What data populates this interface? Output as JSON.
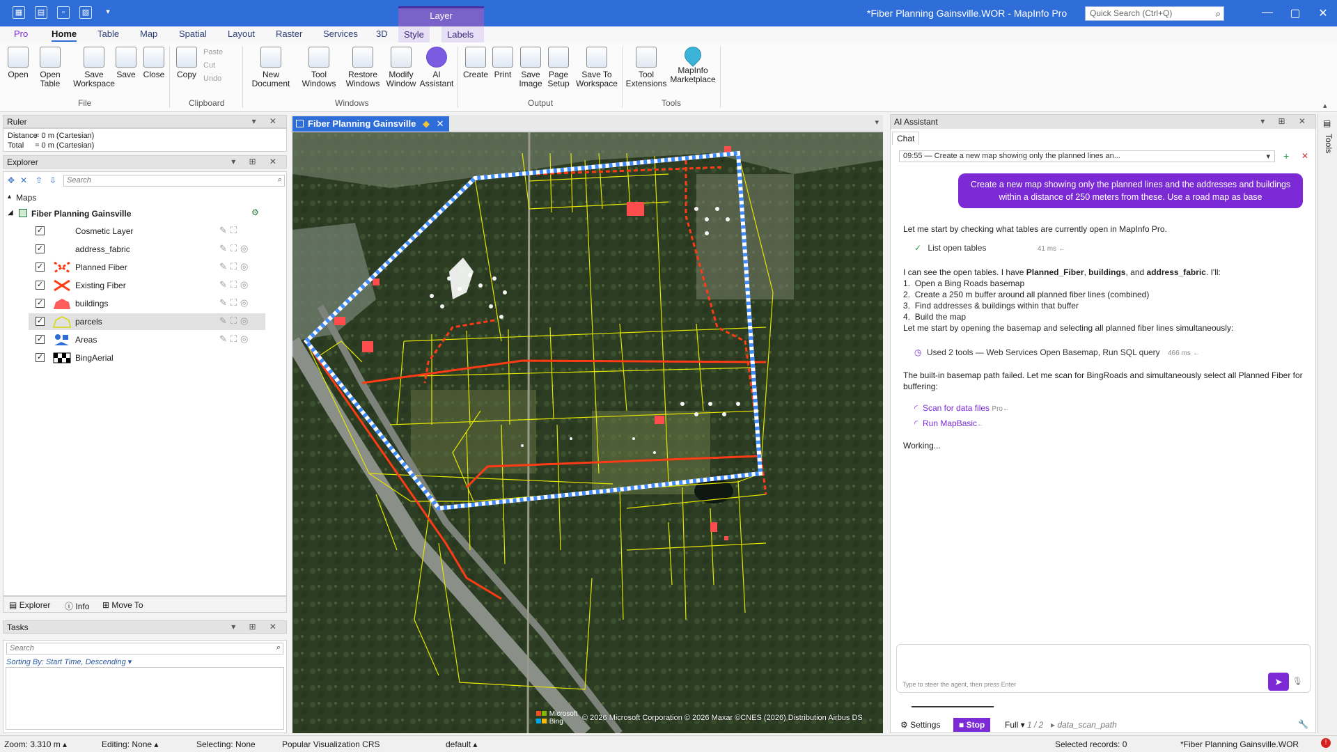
{
  "app": {
    "window_title": "*Fiber Planning Gainsville.WOR - MapInfo Pro",
    "quick_search_placeholder": "Quick Search (Ctrl+Q)",
    "context_group": "Layer",
    "accent": "#2f6ed8",
    "ai_accent": "#7b2ad6"
  },
  "ribbon": {
    "tabs": [
      "Pro",
      "Home",
      "Table",
      "Map",
      "Spatial",
      "Layout",
      "Raster",
      "Services",
      "3D",
      "Style",
      "Labels"
    ],
    "active_tab": "Home",
    "groups": [
      {
        "label": "File",
        "buttons": [
          "Open",
          "Open Table",
          "Save Workspace",
          "Save",
          "Close"
        ]
      },
      {
        "label": "Clipboard",
        "buttons": [
          "Copy"
        ],
        "small": [
          "Paste",
          "Cut",
          "Undo"
        ]
      },
      {
        "label": "Windows",
        "buttons": [
          "New Document",
          "Tool Windows",
          "Restore Windows",
          "Modify Window",
          "AI Assistant"
        ]
      },
      {
        "label": "Output",
        "buttons": [
          "Create",
          "Print",
          "Save Image",
          "Page Setup",
          "Save To Workspace"
        ]
      },
      {
        "label": "Tools",
        "buttons": [
          "Tool Extensions",
          "MapInfo Marketplace"
        ]
      }
    ]
  },
  "ruler": {
    "title": "Ruler",
    "distance_label": "Distance",
    "distance_value": "= 0 m (Cartesian)",
    "total_label": "Total",
    "total_value": "= 0 m (Cartesian)"
  },
  "explorer": {
    "title": "Explorer",
    "search_placeholder": "Search",
    "maps_label": "Maps",
    "map_name": "Fiber Planning Gainsville",
    "layers": [
      {
        "name": "Cosmetic Layer",
        "checked": true
      },
      {
        "name": "address_fabric",
        "checked": true
      },
      {
        "name": "Planned Fiber",
        "checked": true
      },
      {
        "name": "Existing Fiber",
        "checked": true
      },
      {
        "name": "buildings",
        "checked": true
      },
      {
        "name": "parcels",
        "checked": true,
        "selected": true
      },
      {
        "name": "Areas",
        "checked": true
      },
      {
        "name": "BingAerial",
        "checked": true
      }
    ],
    "bottom_tabs": [
      "Explorer",
      "Info",
      "Move To"
    ]
  },
  "tasks": {
    "title": "Tasks",
    "search_placeholder": "Search",
    "sort_label": "Sorting By: Start Time, Descending"
  },
  "map_window": {
    "tab_title": "Fiber Planning Gainsville",
    "attribution": "© 2026 Microsoft Corporation © 2026 Maxar ©CNES (2026) Distribution Airbus DS",
    "logo_text_1": "Microsoft",
    "logo_text_2": "Bing"
  },
  "ai_assistant": {
    "title": "AI Assistant",
    "chat_tab": "Chat",
    "session_label": "09:55  —  Create a new map showing only the planned lines an...",
    "user_message": "Create a new map showing only the planned lines and the addresses and buildings within a distance of 250 meters from these. Use a road map as base",
    "msg1": "Let me start by checking what tables are currently open in MapInfo Pro.",
    "tool1": "List open tables",
    "tool1_ms": "41 ms",
    "msg2_prefix": "I can see the open tables. I have ",
    "msg2_t1": "Planned_Fiber",
    "msg2_sep": ", ",
    "msg2_t2": "buildings",
    "msg2_and": ", and ",
    "msg2_t3": "address_fabric",
    "msg2_suffix": ". I'll:",
    "steps": [
      "Open a Bing Roads basemap",
      "Create a 250 m buffer around all planned fiber lines (combined)",
      "Find addresses & buildings within that buffer",
      "Build the map"
    ],
    "msg3": "Let me start by opening the basemap and selecting all planned fiber lines simultaneously:",
    "tool2": "Used 2 tools — Web Services Open Basemap, Run SQL query",
    "tool2_ms": "466 ms",
    "msg4": "The built-in basemap path failed. Let me scan for BingRoads and simultaneously select all Planned Fiber for buffering:",
    "tool3": "Scan for data files",
    "tool3_tag": "Pro",
    "tool4": "Run MapBasic",
    "working": "Working...",
    "input_placeholder": "Type to steer the agent, then press Enter",
    "footer_settings": "Settings",
    "footer_stop": "Stop",
    "footer_mode": "Full",
    "footer_page": "1 / 2",
    "footer_path": "data_scan_path"
  },
  "tools_strip": "Tools",
  "status": {
    "zoom": "Zoom: 3.310 m",
    "editing": "Editing: None",
    "selecting": "Selecting: None",
    "crs": "Popular Visualization CRS",
    "style": "default",
    "selected_records": "Selected records: 0",
    "workspace": "*Fiber Planning Gainsville.WOR"
  }
}
